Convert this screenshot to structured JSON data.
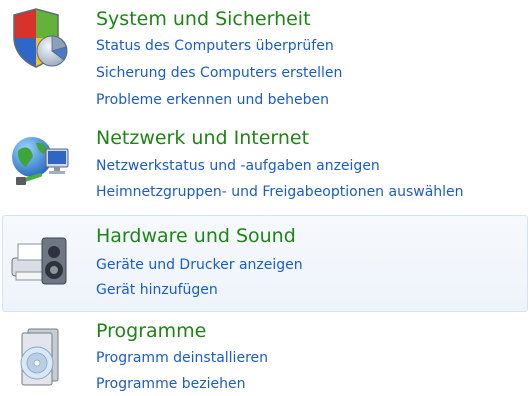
{
  "categories": [
    {
      "title": "System und Sicherheit",
      "icon": "shield-icon",
      "links": [
        "Status des Computers überprüfen",
        "Sicherung des Computers erstellen",
        "Probleme erkennen und beheben"
      ]
    },
    {
      "title": "Netzwerk und Internet",
      "icon": "network-globe-icon",
      "links": [
        "Netzwerkstatus und -aufgaben anzeigen",
        "Heimnetzgruppen- und Freigabeoptionen auswählen"
      ]
    },
    {
      "title": "Hardware und Sound",
      "icon": "printer-speaker-icon",
      "links": [
        "Geräte und Drucker anzeigen",
        "Gerät hinzufügen"
      ]
    },
    {
      "title": "Programme",
      "icon": "programs-disc-icon",
      "links": [
        "Programm deinstallieren",
        "Programme beziehen"
      ]
    }
  ],
  "colors": {
    "title": "#1e8515",
    "link": "#1a5bc9",
    "hover_bg": "#eef4fb",
    "hover_border": "#d5e3f2"
  }
}
